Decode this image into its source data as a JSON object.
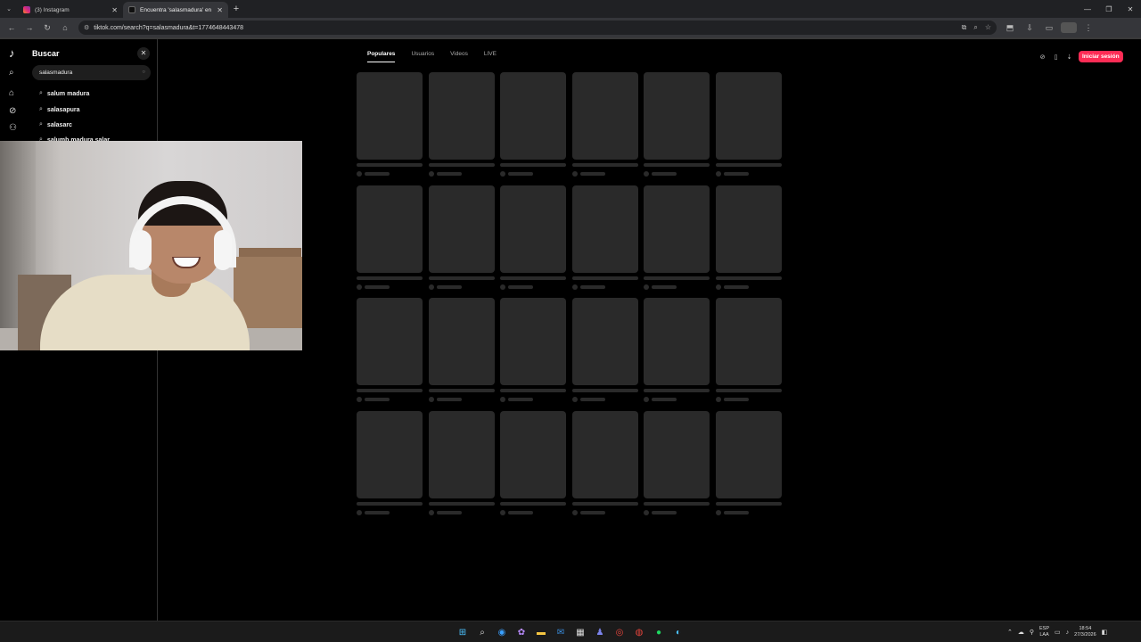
{
  "browser": {
    "tabs": [
      {
        "label": "(3) Instagram",
        "favicon": "instagram-icon",
        "active": false
      },
      {
        "label": "Encuentra 'salasmadura' en Tik",
        "favicon": "tiktok-icon",
        "active": true
      }
    ],
    "url": "tiktok.com/search?q=salasmadura&t=1774648443478"
  },
  "sidebar": {
    "title": "Buscar",
    "search_value": "salasmadura",
    "suggestions": [
      "salum madura",
      "salasapura",
      "salasarc",
      "salumb madura salar"
    ]
  },
  "content": {
    "tabs": [
      {
        "label": "Populares",
        "active": true
      },
      {
        "label": "Usuarios",
        "active": false
      },
      {
        "label": "Videos",
        "active": false
      },
      {
        "label": "LIVE",
        "active": false
      }
    ],
    "login_label": "Iniciar sesión",
    "skeleton_rows": 4,
    "skeleton_cols": 6
  },
  "taskbar": {
    "lang_top": "ESP",
    "lang_bottom": "LAA",
    "time": "18:54",
    "date": "27/3/2026"
  },
  "colors": {
    "accent": "#fe2c55",
    "skeleton": "#2a2a2a",
    "background": "#000000"
  }
}
